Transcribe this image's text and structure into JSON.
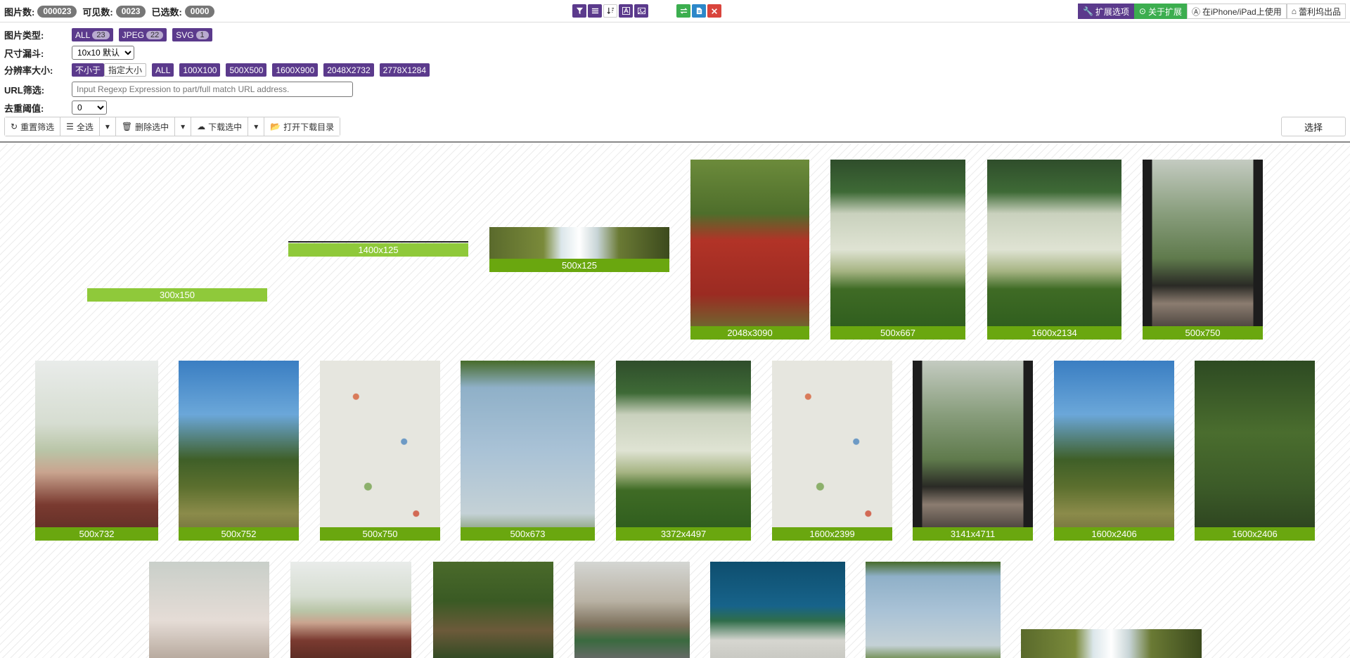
{
  "counts": {
    "images_label": "图片数:",
    "images_value": "000023",
    "visible_label": "可见数:",
    "visible_value": "0023",
    "selected_label": "已选数:",
    "selected_value": "0000"
  },
  "toolbar_icons": [
    "filter-icon",
    "list-icon",
    "sort-icon",
    "text-a-icon",
    "image-icon"
  ],
  "action_icons": [
    "swap-icon",
    "document-icon",
    "close-icon"
  ],
  "topright": {
    "options": "扩展选项",
    "about": "关于扩展",
    "ipad": "在iPhone/iPad上使用",
    "store": "蕾利坞出品"
  },
  "filters": {
    "type_label": "图片类型:",
    "types": [
      {
        "label": "ALL",
        "count": "23"
      },
      {
        "label": "JPEG",
        "count": "22"
      },
      {
        "label": "SVG",
        "count": "1"
      }
    ],
    "funnel_label": "尺寸漏斗:",
    "funnel_value": "10x10 默认",
    "res_label": "分辨率大小:",
    "res_mode_active": "不小于",
    "res_mode_other": "指定大小",
    "res_options": [
      "ALL",
      "100X100",
      "500X500",
      "1600X900",
      "2048X2732",
      "2778X1284"
    ],
    "url_label": "URL筛选:",
    "url_placeholder": "Input Regexp Expression to part/full match URL address.",
    "dedup_label": "去重阈值:",
    "dedup_value": "0"
  },
  "actions": {
    "reset": "重置筛选",
    "select_all": "全选",
    "delete_selected": "删除选中",
    "download_selected": "下载选中",
    "open_download_dir": "打开下载目录",
    "select": "选择"
  },
  "gallery": {
    "row1": [
      {
        "caption": "300x150",
        "fill": "none"
      },
      {
        "caption": "1400x125",
        "fill": "none"
      },
      {
        "caption": "500x125",
        "fill": "falls"
      },
      {
        "caption": "2048x3090",
        "fill": "girls"
      },
      {
        "caption": "500x667",
        "fill": "reeds"
      },
      {
        "caption": "1600x2134",
        "fill": "reeds"
      },
      {
        "caption": "500x750",
        "fill": "window"
      }
    ],
    "row2": [
      {
        "caption": "500x732",
        "fill": "portrait"
      },
      {
        "caption": "500x752",
        "fill": "hill"
      },
      {
        "caption": "500x750",
        "fill": "floral"
      },
      {
        "caption": "500x673",
        "fill": "hoop"
      },
      {
        "caption": "3372x4497",
        "fill": "reeds"
      },
      {
        "caption": "1600x2399",
        "fill": "floral"
      },
      {
        "caption": "3141x4711",
        "fill": "window"
      },
      {
        "caption": "1600x2406",
        "fill": "hill"
      },
      {
        "caption": "1600x2406",
        "fill": "forest"
      }
    ]
  }
}
